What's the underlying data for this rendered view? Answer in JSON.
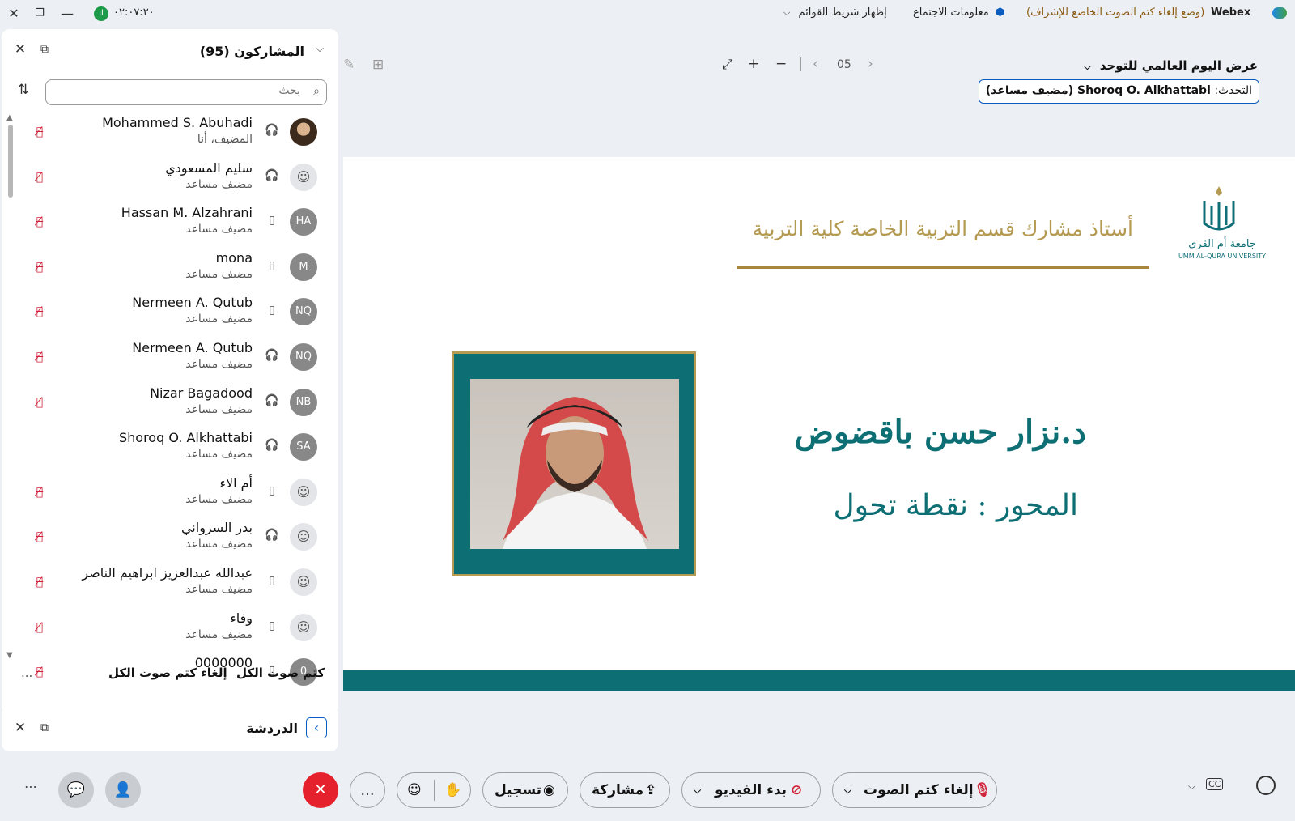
{
  "titlebar": {
    "app_name": "Webex",
    "mode": "(وضع إلغاء كتم الصوت الخاضع للإشراف)",
    "meeting_info": "معلومات الاجتماع",
    "show_menu": "إظهار شريط القوائم",
    "timer": "٠٢:٠٧:٢٠"
  },
  "participants": {
    "title": "المشاركون (95)",
    "search_placeholder": "بحث",
    "rows": [
      {
        "name": "Mohammed S. Abuhadi",
        "role": "المضيف، أنا",
        "initials": "",
        "avatar": "image",
        "device": "headset",
        "muted": true
      },
      {
        "name": "سليم المسعودي",
        "role": "مضيف مساعد",
        "initials": "",
        "avatar": "generic",
        "device": "headset",
        "muted": true
      },
      {
        "name": "Hassan M. Alzahrani",
        "role": "مضيف مساعد",
        "initials": "HA",
        "avatar": "initials",
        "device": "phone",
        "muted": true
      },
      {
        "name": "mona",
        "role": "مضيف مساعد",
        "initials": "M",
        "avatar": "initials",
        "device": "phone",
        "muted": true
      },
      {
        "name": "Nermeen A. Qutub",
        "role": "مضيف مساعد",
        "initials": "NQ",
        "avatar": "initials",
        "device": "phone",
        "muted": true
      },
      {
        "name": "Nermeen A. Qutub",
        "role": "مضيف مساعد",
        "initials": "NQ",
        "avatar": "initials",
        "device": "headset",
        "muted": true
      },
      {
        "name": "Nizar Bagadood",
        "role": "مضيف مساعد",
        "initials": "NB",
        "avatar": "initials",
        "device": "headset",
        "muted": true
      },
      {
        "name": "Shoroq O. Alkhattabi",
        "role": "مضيف مساعد",
        "initials": "SA",
        "avatar": "initials",
        "device": "headset",
        "muted": false
      },
      {
        "name": "أم الاء",
        "role": "مضيف مساعد",
        "initials": "",
        "avatar": "generic",
        "device": "phone",
        "muted": true
      },
      {
        "name": "بدر السرواني",
        "role": "مضيف مساعد",
        "initials": "",
        "avatar": "generic",
        "device": "headset",
        "muted": true
      },
      {
        "name": "عبدالله عبدالعزيز ابراهيم الناصر",
        "role": "مضيف مساعد",
        "initials": "",
        "avatar": "generic",
        "device": "phone",
        "muted": true
      },
      {
        "name": "وفاء",
        "role": "مضيف مساعد",
        "initials": "",
        "avatar": "generic",
        "device": "phone",
        "muted": true
      },
      {
        "name": "0000000",
        "role": "",
        "initials": "0",
        "avatar": "initials",
        "device": "phone",
        "muted": true
      }
    ],
    "mute_all": "كتم صوت الكل",
    "unmute_all": "إلغاء كتم صوت الكل",
    "more": "..."
  },
  "chat": {
    "title": "الدردشة"
  },
  "share": {
    "title": "عرض اليوم العالمي للتوحد",
    "speaking_label": "التحدث:",
    "speaking_name": "Shoroq O. Alkhattabi (مضيف مساعد)",
    "page": "05"
  },
  "slide": {
    "header": "أستاذ مشارك قسم التربية الخاصة كلية التربية",
    "logo_ar": "جامعة أم القرى",
    "logo_en": "UMM AL-QURA UNIVERSITY",
    "name": "د.نزار حسن باقضوض",
    "axis": "المحور : نقطة تحول"
  },
  "controls": {
    "unmute": "إلغاء كتم الصوت",
    "start_video": "بدء الفيديو",
    "share": "مشاركة",
    "record": "تسجيل",
    "more": "..."
  },
  "colors": {
    "accent_blue": "#0b5cc1",
    "slide_teal": "#0d6e74",
    "slide_gold": "#b59a51",
    "end_red": "#e5212e",
    "mute_red": "#d0223a"
  }
}
